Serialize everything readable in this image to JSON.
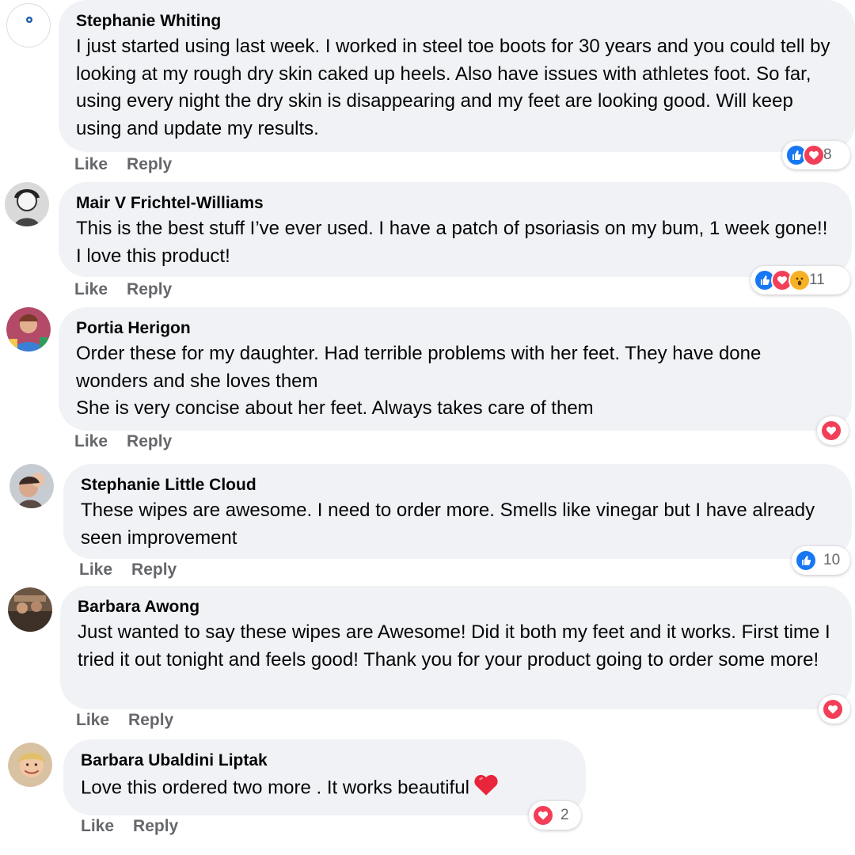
{
  "comments": [
    {
      "author": "Stephanie Whiting",
      "text": "I just started using last week. I worked in steel toe boots for 30 years and you could tell by looking at my rough dry skin caked up heels. Also have issues with athletes foot. So far, using every night the dry skin is disappearing and my feet are looking good. Will keep using and update my results.",
      "like_label": "Like",
      "reply_label": "Reply",
      "reaction_count": "8",
      "reactions": [
        "like",
        "love"
      ]
    },
    {
      "author": "Mair V Frichtel-Williams",
      "text": "This is the best stuff I’ve ever used. I have a patch of psoriasis on my bum, 1 week gone!! I love this product!",
      "like_label": "Like",
      "reply_label": "Reply",
      "reaction_count": "11",
      "reactions": [
        "like",
        "love",
        "wow"
      ]
    },
    {
      "author": "Portia Herigon",
      "text": "Order these for my daughter. Had terrible problems with her feet. They have done wonders and she loves them\nShe is very concise about her feet. Always takes care of them",
      "like_label": "Like",
      "reply_label": "Reply",
      "reaction_count": "",
      "reactions": [
        "love"
      ]
    },
    {
      "author": "Stephanie Little Cloud",
      "text": "These wipes are awesome. I need to order more. Smells like vinegar but I have already seen improvement",
      "like_label": "Like",
      "reply_label": "Reply",
      "reaction_count": "10",
      "reactions": [
        "like"
      ]
    },
    {
      "author": "Barbara Awong",
      "text": "Just wanted to say these wipes are Awesome! Did it both my feet and it works. First time I tried it out tonight and feels good! Thank you for your product going to order some more!",
      "like_label": "Like",
      "reply_label": "Reply",
      "reaction_count": "",
      "reactions": [
        "love"
      ]
    },
    {
      "author": "Barbara Ubaldini Liptak",
      "text": "Love this ordered two more . It works beautiful",
      "like_label": "Like",
      "reply_label": "Reply",
      "reaction_count": "2",
      "reactions": [
        "love"
      ]
    }
  ],
  "colors": {
    "bubble": "#f0f2f5",
    "like": "#1877f2",
    "love": "#f33e58",
    "wow": "#f7b125",
    "meta_text": "#65676b"
  }
}
